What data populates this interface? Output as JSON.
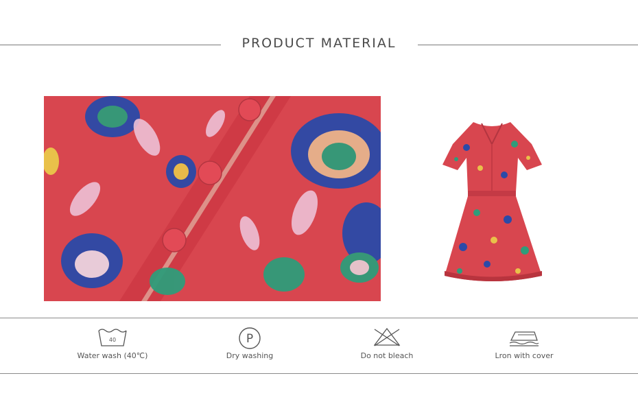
{
  "section": {
    "title": "PRODUCT MATERIAL"
  },
  "images": {
    "closeup": {
      "icon": "floral-fabric-closeup-photo"
    },
    "dress": {
      "icon": "floral-dress-photo"
    }
  },
  "care": [
    {
      "label": "Water wash (40℃)",
      "icon": "wash-40-icon",
      "badge": "40"
    },
    {
      "label": "Dry washing",
      "icon": "dry-clean-p-icon",
      "badge": "P"
    },
    {
      "label": "Do not bleach",
      "icon": "no-bleach-icon"
    },
    {
      "label": "Lron with cover",
      "icon": "iron-with-cover-icon"
    }
  ],
  "colors": {
    "fabric": "#d9414d",
    "accent_blue": "#2b4aa8",
    "accent_green": "#2f9c7a",
    "line": "#7a7a7a"
  }
}
